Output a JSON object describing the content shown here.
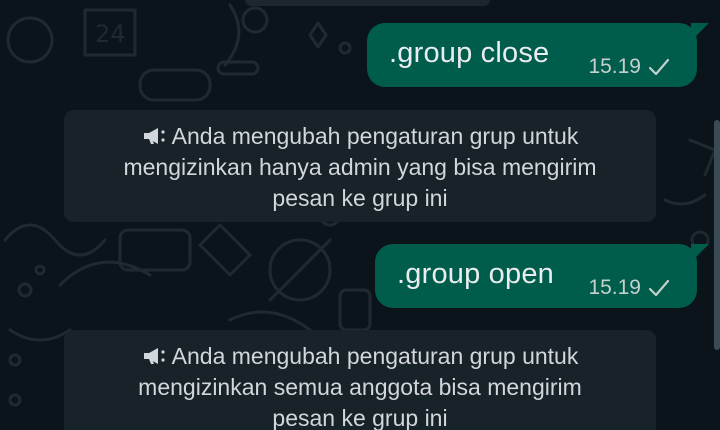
{
  "messages": [
    {
      "text": ".group close",
      "time": "15.19",
      "status_icon": "single-check-icon"
    },
    {
      "text": ".group open",
      "time": "15.19",
      "status_icon": "single-check-icon"
    }
  ],
  "system_notices": [
    {
      "icon": "megaphone-icon",
      "lines": [
        "Anda mengubah pengaturan grup untuk",
        "mengizinkan hanya admin yang bisa mengirim",
        "pesan ke grup ini"
      ]
    },
    {
      "icon": "megaphone-icon",
      "lines": [
        "Anda mengubah pengaturan grup untuk",
        "mengizinkan semua anggota bisa mengirim",
        "pesan ke grup ini"
      ]
    }
  ],
  "colors": {
    "background": "#0b141a",
    "outgoing_bubble": "#005c4b",
    "system_bubble": "#182229",
    "text_primary": "#e9edef",
    "text_secondary": "#c5d1cc"
  }
}
